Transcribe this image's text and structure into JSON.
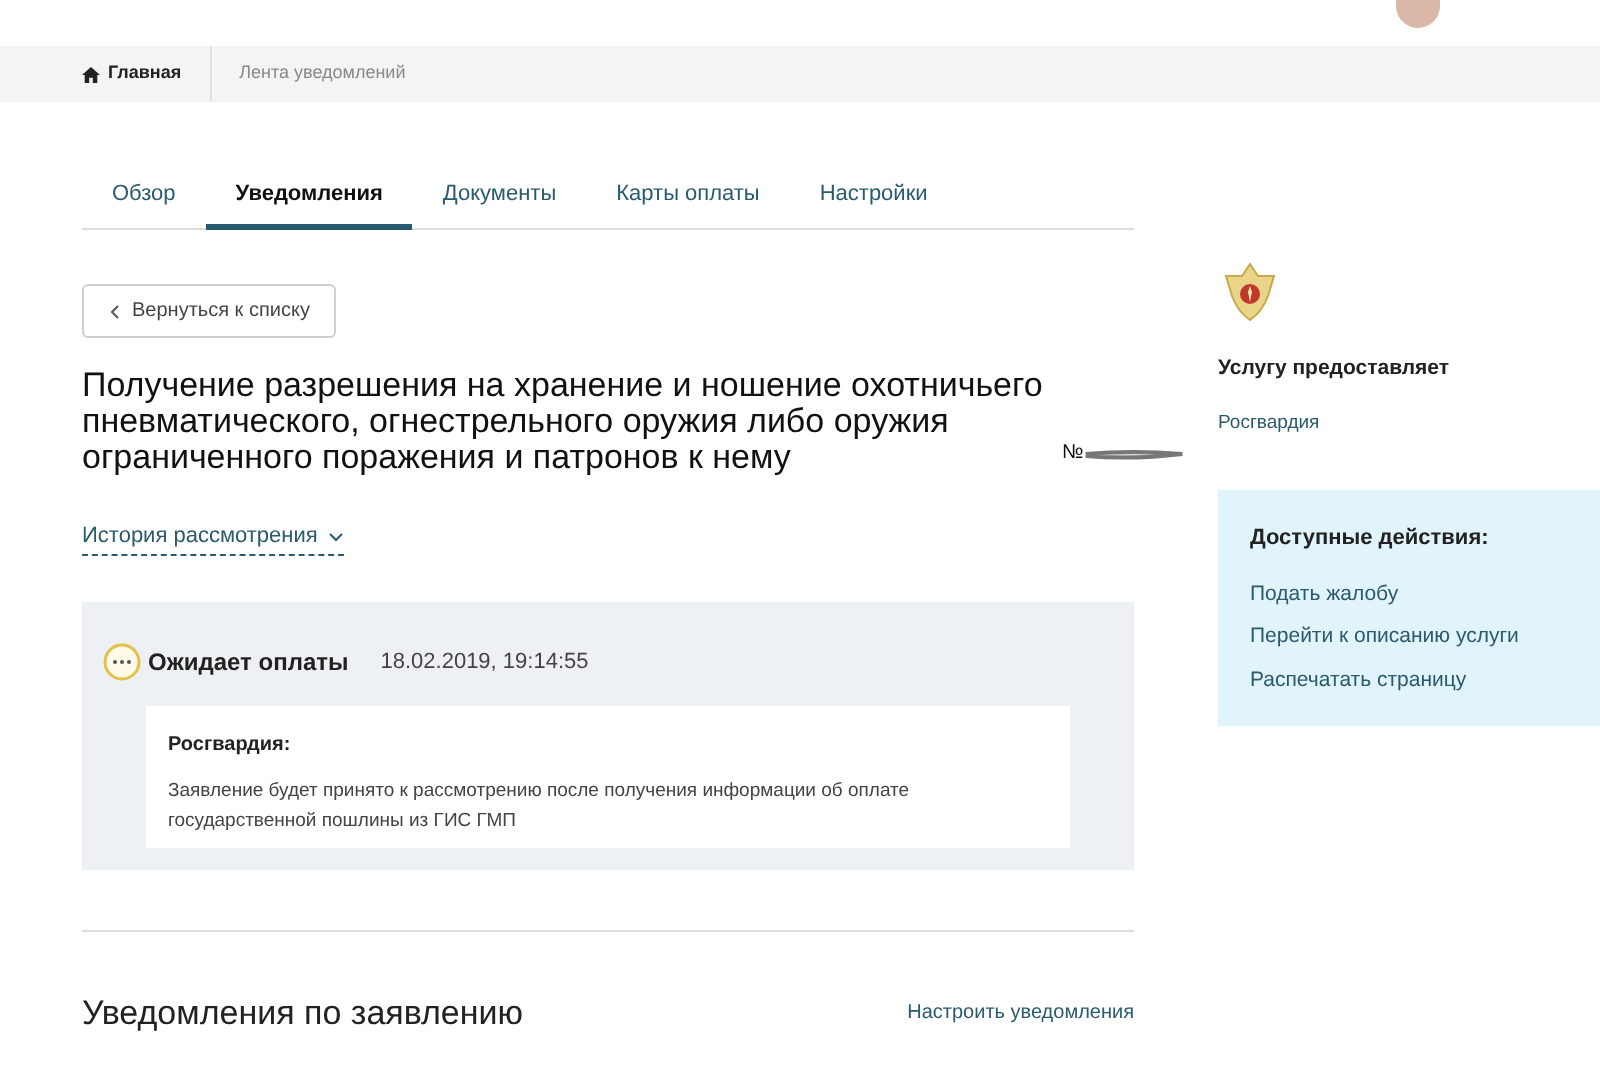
{
  "breadcrumbs": [
    {
      "label": "Главная",
      "kind": "home"
    },
    {
      "label": "Лента уведомлений",
      "kind": "current"
    }
  ],
  "tabs": [
    {
      "label": "Обзор",
      "selected": false
    },
    {
      "label": "Уведомления",
      "selected": true
    },
    {
      "label": "Документы",
      "selected": false
    },
    {
      "label": "Карты оплаты",
      "selected": false
    },
    {
      "label": "Настройки",
      "selected": false
    }
  ],
  "back_button": "Вернуться к списку",
  "title": "Получение разрешения на хранение и ношение охотничьего пневматического, огнестрельного оружия либо оружия ограниченного поражения и патронов к нему",
  "number_label": "№",
  "history_link": "История рассмотрения",
  "status": {
    "label": "Ожидает оплаты",
    "datetime": "18.02.2019, 19:14:55",
    "message_author": "Росгвардия:",
    "message": "Заявление будет принято к рассмотрению после получения информации об оплате государственной пошлины из ГИС ГМП"
  },
  "provider": {
    "heading": "Услугу предоставляет",
    "name": "Росгвардия"
  },
  "actions": {
    "heading": "Доступные действия:",
    "items": [
      "Подать жалобу",
      "Перейти к описанию услуги",
      "Распечатать страницу"
    ]
  },
  "notifications": {
    "heading": "Уведомления по заявлению",
    "settings_link": "Настроить уведомления"
  }
}
